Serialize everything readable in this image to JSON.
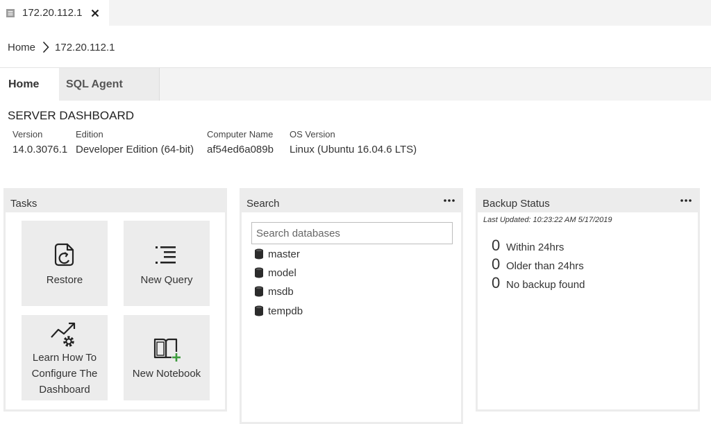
{
  "tab": {
    "title": "172.20.112.1"
  },
  "breadcrumb": {
    "home": "Home",
    "current": "172.20.112.1"
  },
  "dashboard_tabs": [
    "Home",
    "SQL Agent"
  ],
  "server": {
    "title": "SERVER DASHBOARD",
    "properties": [
      {
        "label": "Version",
        "value": "14.0.3076.1"
      },
      {
        "label": "Edition",
        "value": "Developer Edition (64-bit)"
      },
      {
        "label": "Computer Name",
        "value": "af54ed6a089b"
      },
      {
        "label": "OS Version",
        "value": "Linux (Ubuntu 16.04.6 LTS)"
      }
    ]
  },
  "tasks": {
    "title": "Tasks",
    "items": [
      {
        "label": "Restore",
        "icon": "restore-icon"
      },
      {
        "label": "New Query",
        "icon": "new-query-icon"
      },
      {
        "label_lines": [
          "Learn How To",
          "Configure The",
          "Dashboard"
        ],
        "icon": "configure-dashboard-icon"
      },
      {
        "label": "New Notebook",
        "icon": "new-notebook-icon"
      }
    ]
  },
  "search": {
    "title": "Search",
    "placeholder": "Search databases",
    "databases": [
      "master",
      "model",
      "msdb",
      "tempdb"
    ]
  },
  "backup": {
    "title": "Backup Status",
    "last_updated": "Last Updated: 10:23:22 AM 5/17/2019",
    "rows": [
      {
        "count": "0",
        "label": "Within 24hrs"
      },
      {
        "count": "0",
        "label": "Older than 24hrs"
      },
      {
        "count": "0",
        "label": "No backup found"
      }
    ]
  },
  "colors": {
    "panel_header": "#ececec",
    "accent_green": "#3c9a3c"
  }
}
